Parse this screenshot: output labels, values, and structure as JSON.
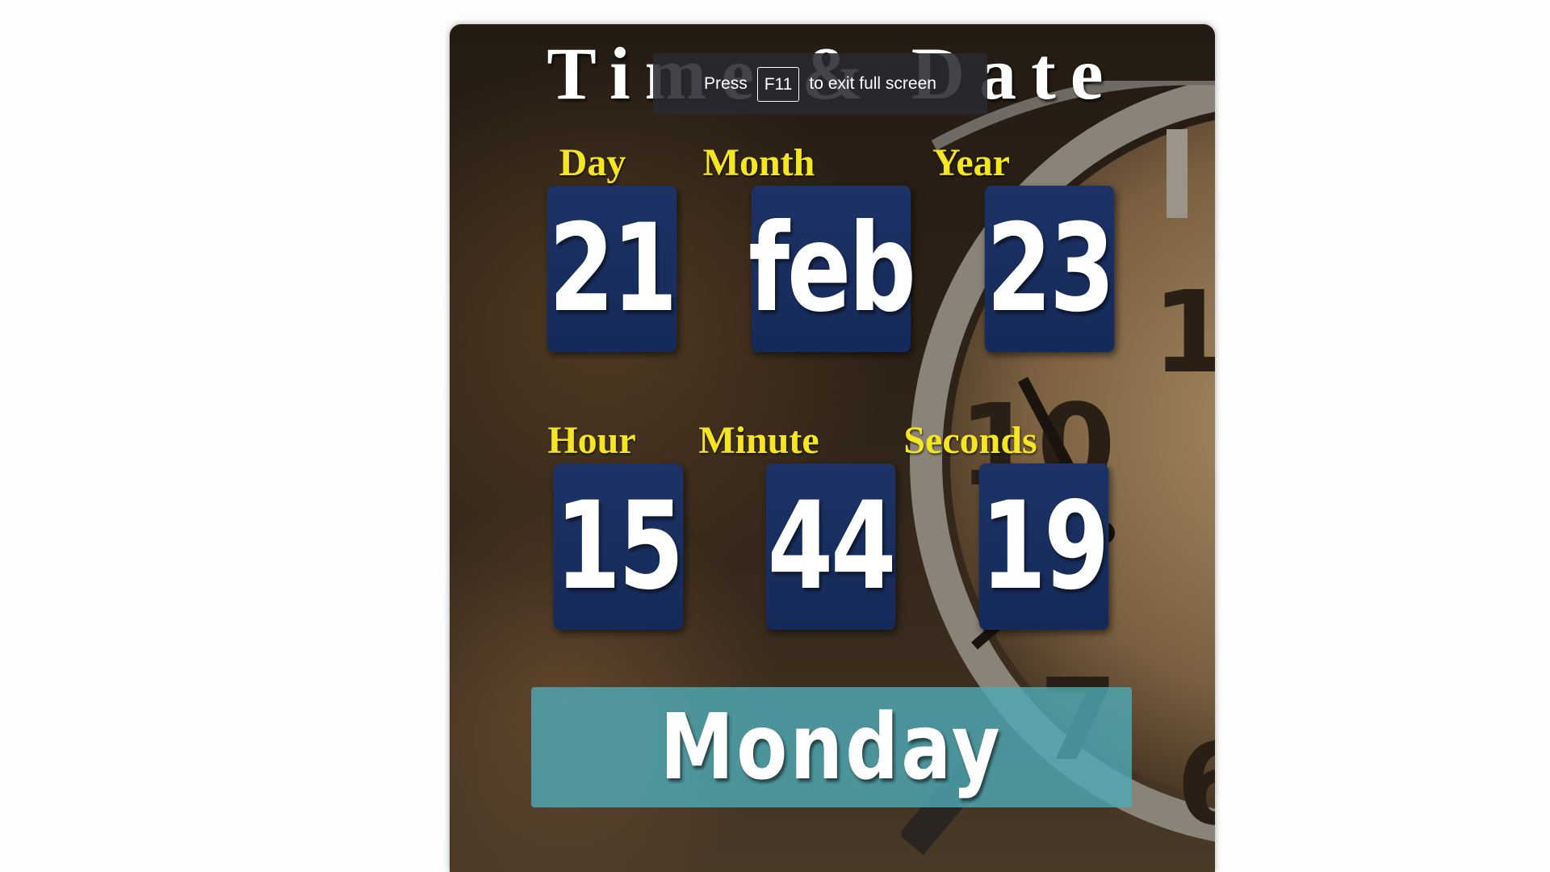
{
  "title": "Time & Date",
  "fullscreen_notice": {
    "prefix": "Press",
    "key": "F11",
    "suffix": "to exit full screen"
  },
  "date": {
    "day": {
      "label": "Day",
      "value": "21"
    },
    "month": {
      "label": "Month",
      "value": "feb"
    },
    "year": {
      "label": "Year",
      "value": "23"
    }
  },
  "time": {
    "hour": {
      "label": "Hour",
      "value": "15"
    },
    "minute": {
      "label": "Minute",
      "value": "44"
    },
    "seconds": {
      "label": "Seconds",
      "value": "19"
    }
  },
  "weekday": "Monday",
  "colors": {
    "label": "#f6e620",
    "tile": "#1d3366",
    "weekday_bar": "#4ea8b4",
    "background": "#2e2217"
  },
  "background_icon": "alarm-clock-icon"
}
